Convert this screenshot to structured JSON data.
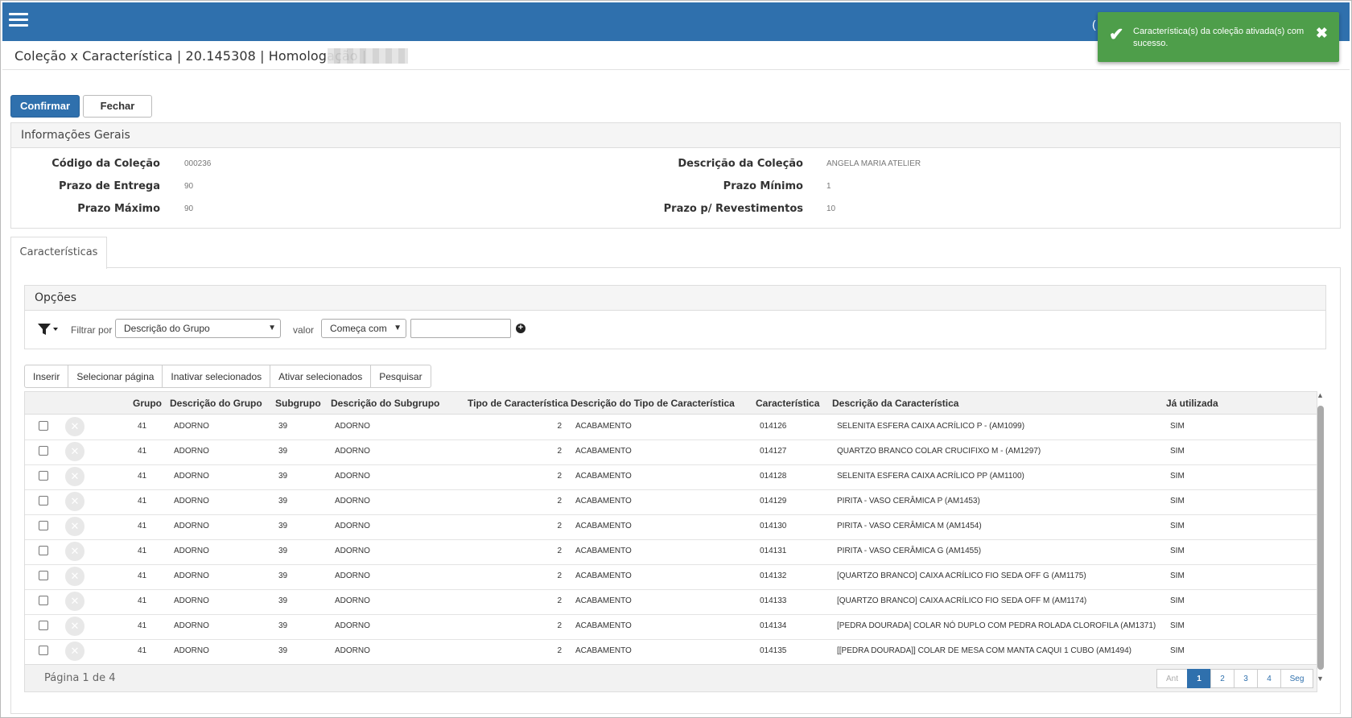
{
  "header": {
    "title": "Coleção x Característica | 20.145308 | Homologação |",
    "paren": "("
  },
  "toast": {
    "message": "Característica(s) da coleção ativada(s) com sucesso.",
    "check_icon": "✔",
    "close_icon": "✖",
    "color": "#4e9e4a"
  },
  "buttons": {
    "confirm": "Confirmar",
    "close": "Fechar"
  },
  "info": {
    "heading": "Informações Gerais",
    "fields": [
      {
        "label": "Código da Coleção",
        "value": "000236"
      },
      {
        "label": "Prazo de Entrega",
        "value": "90"
      },
      {
        "label": "Prazo Máximo",
        "value": "90"
      },
      {
        "label": "Descrição da Coleção",
        "value": "ANGELA MARIA ATELIER"
      },
      {
        "label": "Prazo Mínimo",
        "value": "1"
      },
      {
        "label": "Prazo p/ Revestimentos",
        "value": "10"
      }
    ]
  },
  "tab": {
    "label": "Características"
  },
  "options": {
    "heading": "Opções",
    "filter_label": "Filtrar por",
    "filter_value": "Descrição do Grupo",
    "value_label": "valor",
    "operator_value": "Começa com",
    "text_value": ""
  },
  "actions": [
    "Inserir",
    "Selecionar página",
    "Inativar selecionados",
    "Ativar selecionados",
    "Pesquisar"
  ],
  "table": {
    "columns": [
      "Grupo",
      "Descrição do Grupo",
      "Subgrupo",
      "Descrição do Subgrupo",
      "Tipo de Característica",
      "Descrição do Tipo de Característica",
      "Característica",
      "Descrição da Característica",
      "Já utilizada"
    ],
    "rows": [
      [
        "41",
        "ADORNO",
        "39",
        "ADORNO",
        "2",
        "ACABAMENTO",
        "014126",
        "SELENITA ESFERA CAIXA ACRÍLICO P - (AM1099)",
        "SIM"
      ],
      [
        "41",
        "ADORNO",
        "39",
        "ADORNO",
        "2",
        "ACABAMENTO",
        "014127",
        "QUARTZO BRANCO COLAR CRUCIFIXO M - (AM1297)",
        "SIM"
      ],
      [
        "41",
        "ADORNO",
        "39",
        "ADORNO",
        "2",
        "ACABAMENTO",
        "014128",
        "SELENITA ESFERA CAIXA ACRÍLICO PP (AM1100)",
        "SIM"
      ],
      [
        "41",
        "ADORNO",
        "39",
        "ADORNO",
        "2",
        "ACABAMENTO",
        "014129",
        "PIRITA - VASO CERÂMICA P (AM1453)",
        "SIM"
      ],
      [
        "41",
        "ADORNO",
        "39",
        "ADORNO",
        "2",
        "ACABAMENTO",
        "014130",
        "PIRITA - VASO CERÂMICA M (AM1454)",
        "SIM"
      ],
      [
        "41",
        "ADORNO",
        "39",
        "ADORNO",
        "2",
        "ACABAMENTO",
        "014131",
        "PIRITA - VASO CERÂMICA G (AM1455)",
        "SIM"
      ],
      [
        "41",
        "ADORNO",
        "39",
        "ADORNO",
        "2",
        "ACABAMENTO",
        "014132",
        "[QUARTZO BRANCO] CAIXA ACRÍLICO FIO SEDA OFF G (AM1175)",
        "SIM"
      ],
      [
        "41",
        "ADORNO",
        "39",
        "ADORNO",
        "2",
        "ACABAMENTO",
        "014133",
        "[QUARTZO BRANCO] CAIXA ACRÍLICO FIO SEDA OFF M (AM1174)",
        "SIM"
      ],
      [
        "41",
        "ADORNO",
        "39",
        "ADORNO",
        "2",
        "ACABAMENTO",
        "014134",
        "[PEDRA DOURADA] COLAR NÓ DUPLO COM PEDRA ROLADA CLOROFILA (AM1371)",
        "SIM"
      ],
      [
        "41",
        "ADORNO",
        "39",
        "ADORNO",
        "2",
        "ACABAMENTO",
        "014135",
        "[[PEDRA DOURADA]] COLAR DE MESA COM MANTA CAQUI 1 CUBO (AM1494)",
        "SIM"
      ]
    ]
  },
  "pagination": {
    "info": "Página 1 de 4",
    "prev": "Ant",
    "pages": [
      "1",
      "2",
      "3",
      "4"
    ],
    "next": "Seg"
  },
  "colors": {
    "brand": "#2f70ad"
  }
}
